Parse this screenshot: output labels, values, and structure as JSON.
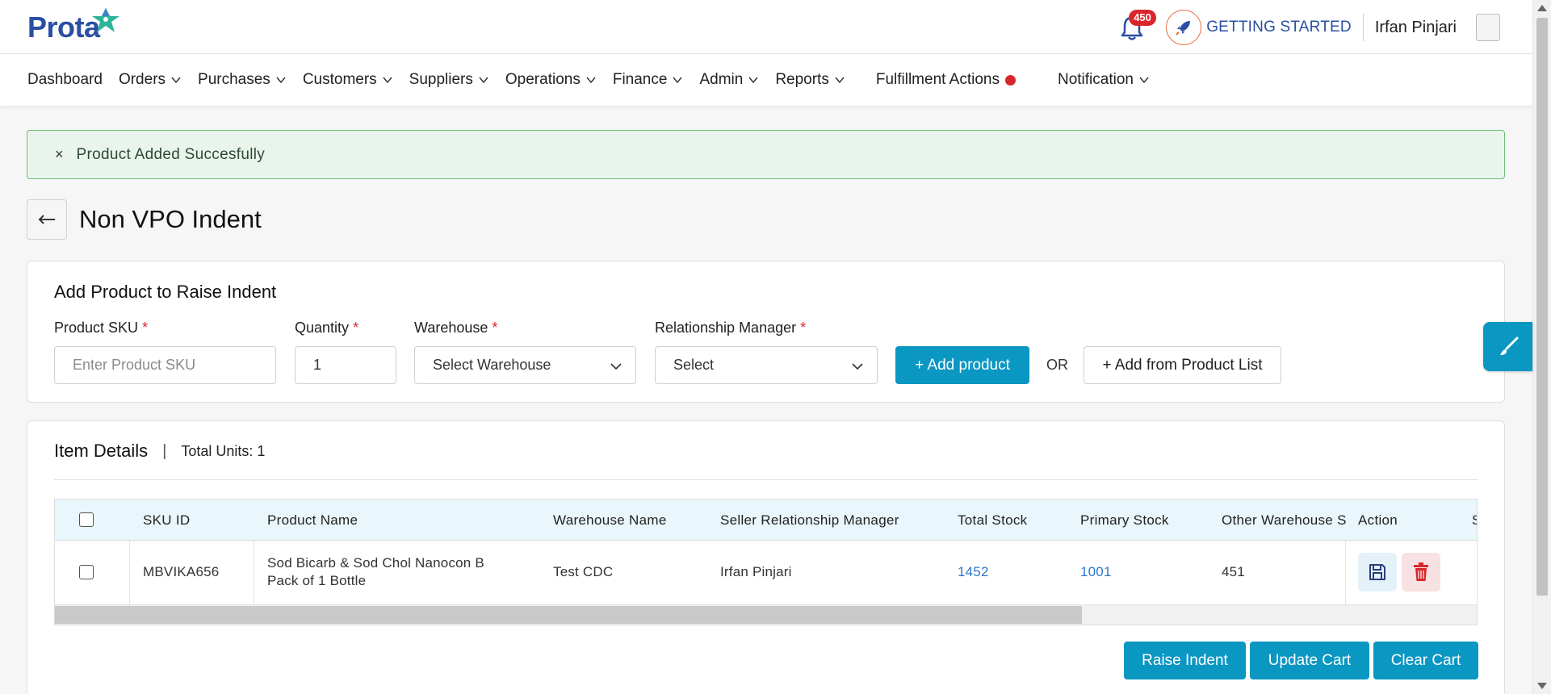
{
  "header": {
    "logo_text": "Prota",
    "notification_count": "450",
    "getting_started": "GETTING STARTED",
    "user_name": "Irfan Pinjari"
  },
  "nav": {
    "items": [
      {
        "label": "Dashboard"
      },
      {
        "label": "Orders"
      },
      {
        "label": "Purchases"
      },
      {
        "label": "Customers"
      },
      {
        "label": "Suppliers"
      },
      {
        "label": "Operations"
      },
      {
        "label": "Finance"
      },
      {
        "label": "Admin"
      },
      {
        "label": "Reports"
      },
      {
        "label": "Fulfillment Actions"
      },
      {
        "label": "Notification"
      }
    ]
  },
  "alert": {
    "close": "×",
    "message": "Product Added Succesfully"
  },
  "page": {
    "title": "Non VPO Indent"
  },
  "add_product": {
    "title": "Add Product to Raise Indent",
    "sku_label": "Product SKU",
    "sku_placeholder": "Enter Product SKU",
    "quantity_label": "Quantity",
    "quantity_value": "1",
    "warehouse_label": "Warehouse",
    "warehouse_value": "Select Warehouse",
    "rm_label": "Relationship Manager",
    "rm_value": "Select",
    "required_mark": "*",
    "add_button": "+ Add product",
    "or_text": "OR",
    "add_from_list_button": "+ Add from Product List"
  },
  "items": {
    "title": "Item Details",
    "separator": "|",
    "total_units": "Total Units: 1",
    "columns": [
      "SKU ID",
      "Product Name",
      "Warehouse Name",
      "Seller Relationship Manager",
      "Total Stock",
      "Primary Stock",
      "Other Warehouse S",
      "Action",
      "S"
    ],
    "rows": [
      {
        "sku_id": "MBVIKA656",
        "product_name_line1": "Sod Bicarb & Sod Chol Nanocon B",
        "product_name_line2": "Pack of 1 Bottle",
        "warehouse_name": "Test CDC",
        "seller_rm": "Irfan Pinjari",
        "total_stock": "1452",
        "primary_stock": "1001",
        "other_warehouse_stock": "451"
      }
    ],
    "raise_indent": "Raise Indent",
    "update_cart": "Update Cart",
    "clear_cart": "Clear Cart"
  },
  "colors": {
    "brand_blue": "#2a4fa3",
    "accent": "#0a97c2",
    "danger": "#d9262c",
    "success_bg": "#e9f5ec",
    "success_border": "#6cbd79",
    "link": "#2e78c9"
  }
}
